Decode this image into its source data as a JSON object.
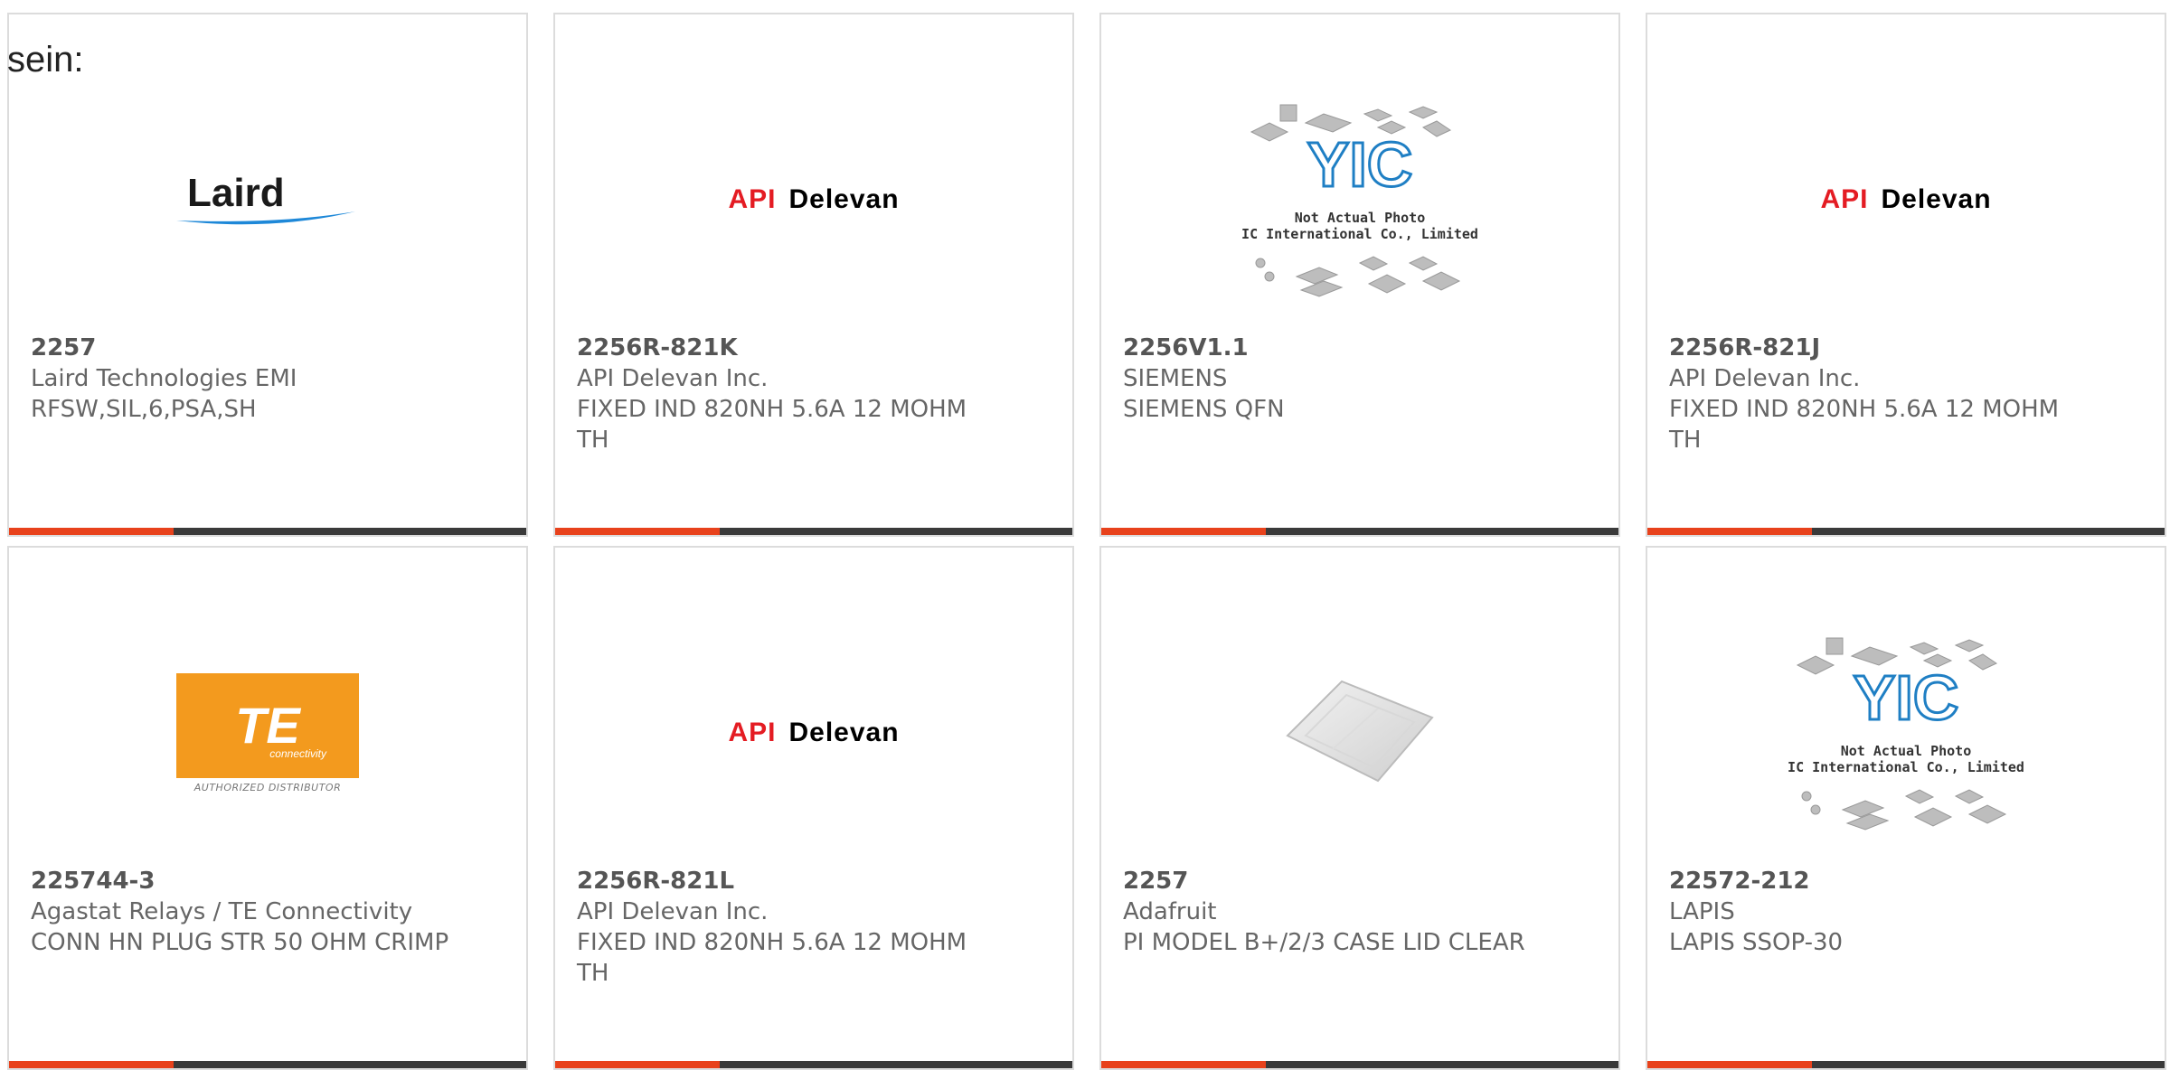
{
  "intro_text": "sein:",
  "cards": [
    {
      "part_number": "2257",
      "manufacturer": "Laird Technologies EMI",
      "description": "RFSW,SIL,6,PSA,SH",
      "image": "laird-logo",
      "logo_text": "Laird"
    },
    {
      "part_number": "2256R-821K",
      "manufacturer": "API Delevan Inc.",
      "description": "FIXED IND 820NH 5.6A 12 MOHM TH",
      "image": "api-delevan-logo",
      "logo_api": "API",
      "logo_delevan": "Delevan"
    },
    {
      "part_number": "2256V1.1",
      "manufacturer": "SIEMENS",
      "description": "SIEMENS QFN",
      "image": "yic-placeholder",
      "yic_line1": "Not Actual Photo",
      "yic_line2": "YIC International Co., Limited."
    },
    {
      "part_number": "2256R-821J",
      "manufacturer": "API Delevan Inc.",
      "description": "FIXED IND 820NH 5.6A 12 MOHM TH",
      "image": "api-delevan-logo",
      "logo_api": "API",
      "logo_delevan": "Delevan"
    },
    {
      "part_number": "225744-3",
      "manufacturer": "Agastat Relays / TE Connectivity",
      "description": "CONN HN PLUG STR 50 OHM CRIMP",
      "image": "te-connectivity-logo",
      "logo_te": "TE",
      "logo_te_sub": "connectivity",
      "logo_te_auth": "AUTHORIZED DISTRIBUTOR"
    },
    {
      "part_number": "2256R-821L",
      "manufacturer": "API Delevan Inc.",
      "description": "FIXED IND 820NH 5.6A 12 MOHM TH",
      "image": "api-delevan-logo",
      "logo_api": "API",
      "logo_delevan": "Delevan"
    },
    {
      "part_number": "2257",
      "manufacturer": "Adafruit",
      "description": "PI MODEL B+/2/3 CASE LID CLEAR",
      "image": "case-lid-photo"
    },
    {
      "part_number": "22572-212",
      "manufacturer": "LAPIS",
      "description": "LAPIS SSOP-30",
      "image": "yic-placeholder",
      "yic_line1": "Not Actual Photo",
      "yic_line2": "YIC International Co., Limited."
    }
  ],
  "colors": {
    "accent_bar": "#e8421c",
    "dark_bar": "#3a3a3a",
    "border": "#dcdcdc"
  }
}
